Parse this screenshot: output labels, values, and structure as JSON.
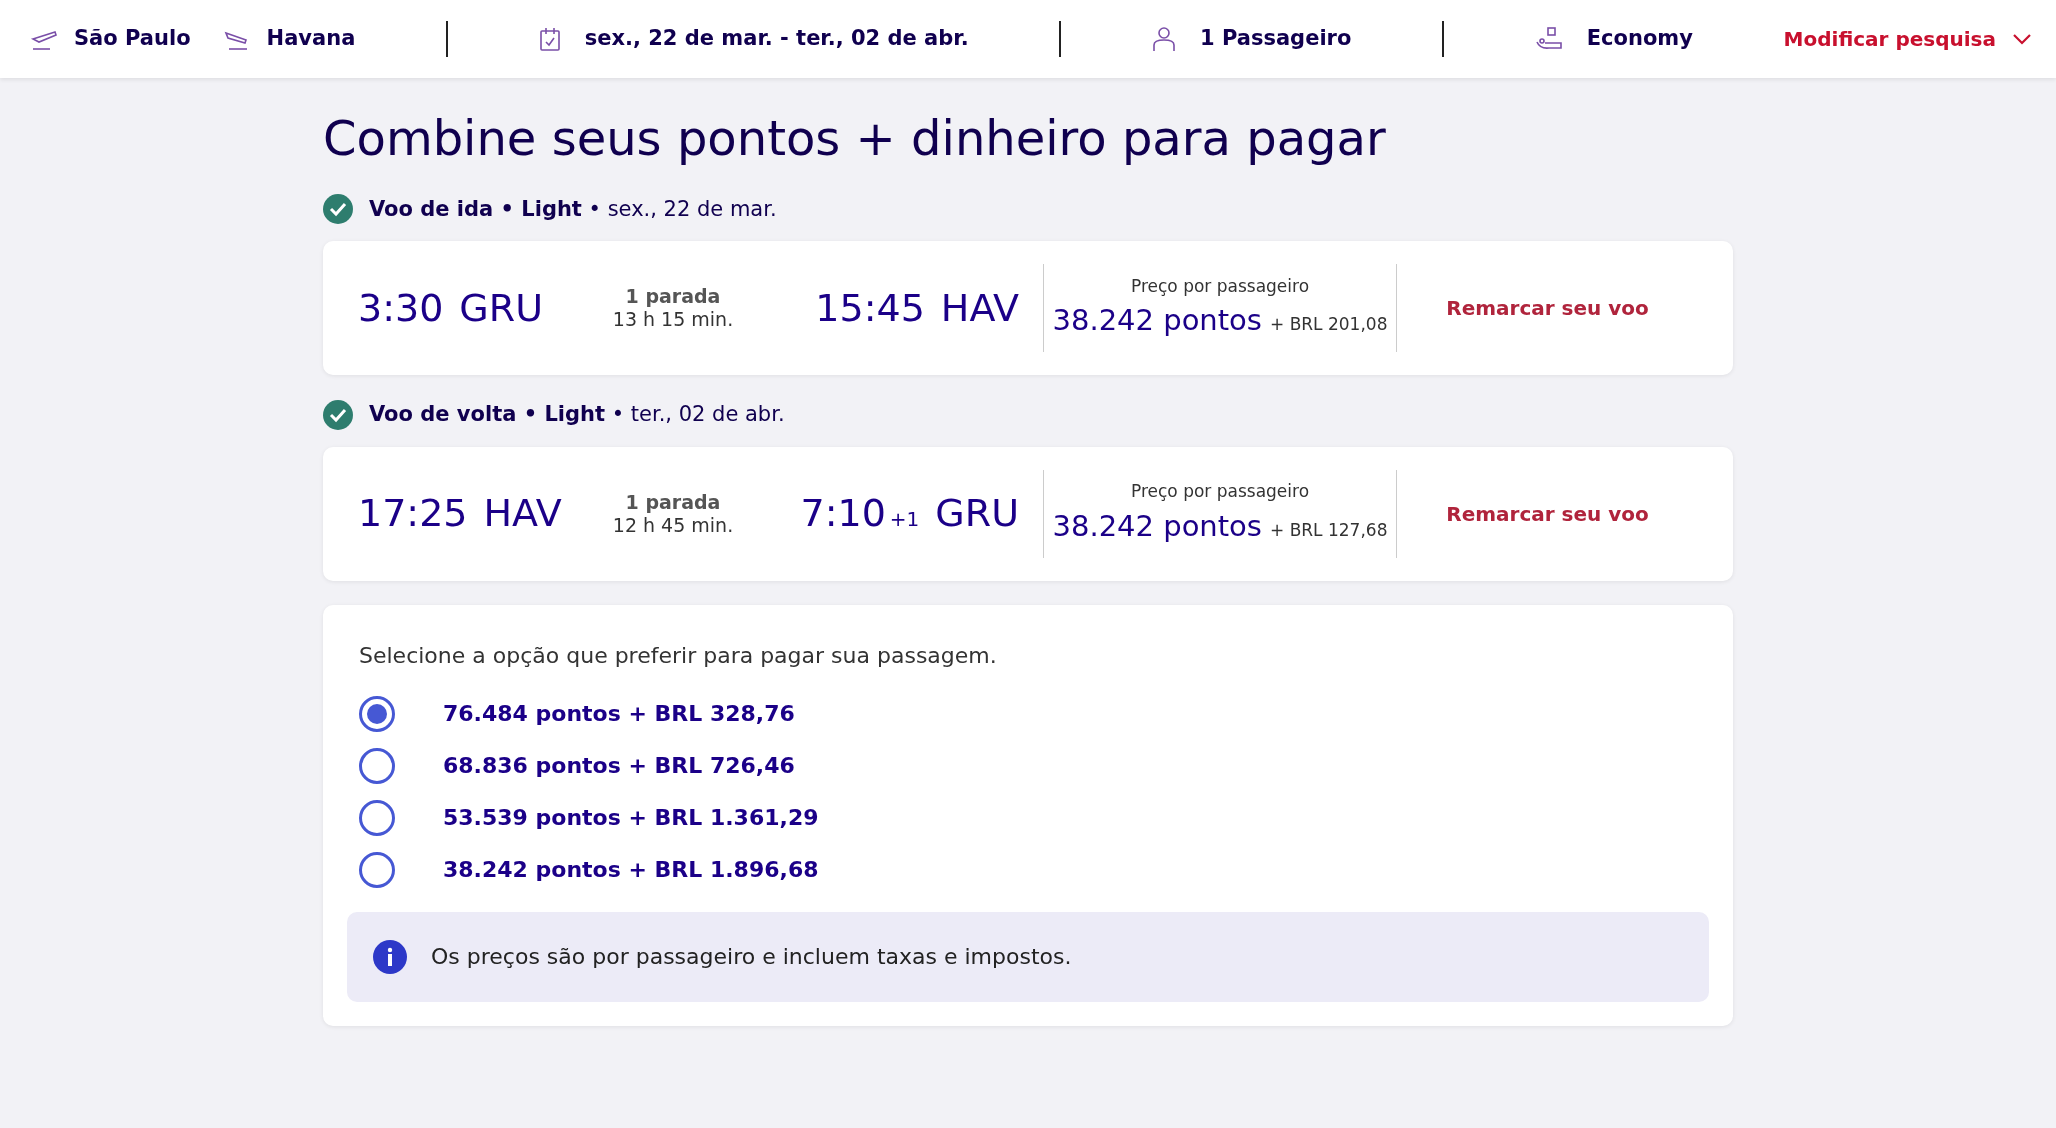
{
  "header": {
    "origin": "São Paulo",
    "destination": "Havana",
    "dates": "sex., 22 de mar. - ter., 02 de abr.",
    "passengers": "1 Passageiro",
    "cabin": "Economy",
    "modify": "Modificar pesquisa"
  },
  "title": "Combine seus pontos + dinheiro para pagar",
  "flights": [
    {
      "label": "**Voo de ida • Light** • sex., 22 de mar.",
      "dep_time": "3:30",
      "dep_airport": "GRU",
      "stops": "1 parada",
      "duration": "13 h 15 min.",
      "arr_time": "15:45",
      "arr_airport": "HAV",
      "price_label": "Preço por passageiro",
      "points": "38.242 pontos",
      "cash": "+ BRL 201,08",
      "action": "Remarcar seu voo"
    },
    {
      "label": "**Voo de volta • Light** • ter., 02 de abr.",
      "dep_time": "17:25",
      "dep_airport": "HAV",
      "stops": "1 parada",
      "duration": "12 h 45 min.",
      "arr_time": "7:10",
      "arr_day_offset": "+1",
      "arr_airport": "GRU",
      "price_label": "Preço por passageiro",
      "points": "38.242 pontos",
      "cash": "+ BRL 127,68",
      "action": "Remarcar seu voo"
    }
  ],
  "payment": {
    "prompt": "Selecione a opção que preferir para pagar sua passagem.",
    "options": [
      {
        "label": "76.484 pontos + BRL 328,76",
        "selected": true
      },
      {
        "label": "68.836 pontos + BRL 726,46",
        "selected": false
      },
      {
        "label": "53.539 pontos + BRL 1.361,29",
        "selected": false
      },
      {
        "label": "38.242 pontos + BRL 1.896,68",
        "selected": false
      }
    ],
    "note": "Os preços são por passageiro e incluem taxas e impostos."
  }
}
